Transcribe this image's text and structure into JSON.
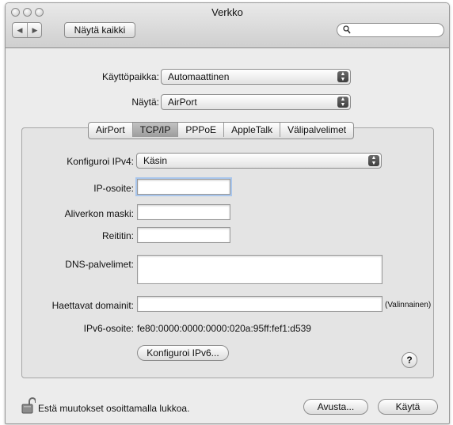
{
  "window": {
    "title": "Verkko"
  },
  "toolbar": {
    "show_all_label": "Näytä kaikki",
    "search_placeholder": "",
    "back_icon": "back-arrow-icon",
    "forward_icon": "forward-arrow-icon",
    "search_icon": "magnifier-icon"
  },
  "location": {
    "label": "Käyttöpaikka:",
    "value": "Automaattinen"
  },
  "show": {
    "label": "Näytä:",
    "value": "AirPort"
  },
  "tabs": [
    {
      "label": "AirPort",
      "selected": false
    },
    {
      "label": "TCP/IP",
      "selected": true
    },
    {
      "label": "PPPoE",
      "selected": false
    },
    {
      "label": "AppleTalk",
      "selected": false
    },
    {
      "label": "Välipalvelimet",
      "selected": false
    }
  ],
  "tcpip": {
    "configure_label": "Konfiguroi IPv4:",
    "configure_value": "Käsin",
    "ip_label": "IP-osoite:",
    "ip_value": "",
    "subnet_label": "Aliverkon maski:",
    "subnet_value": "",
    "router_label": "Reititin:",
    "router_value": "",
    "dns_label": "DNS-palvelimet:",
    "dns_value": "",
    "search_domains_label": "Haettavat domainit:",
    "search_domains_value": "",
    "optional_label": "(Valinnainen)",
    "ipv6_label": "IPv6-osoite:",
    "ipv6_value": "fe80:0000:0000:0000:020a:95ff:fef1:d539",
    "configure_ipv6_button": "Konfiguroi IPv6...",
    "help_label": "?"
  },
  "footer": {
    "lock_text": "Estä muutokset osoittamalla lukkoa.",
    "assist_button": "Avusta...",
    "apply_button": "Käytä",
    "lock_icon": "padlock-open-icon"
  },
  "colors": {
    "window_bg": "#ececec",
    "panel_bg": "#e4e4e4",
    "focus_ring": "#a9c6ec"
  }
}
